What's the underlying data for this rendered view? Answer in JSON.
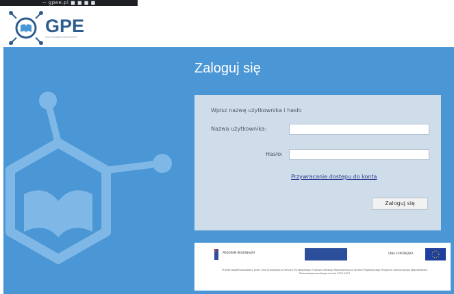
{
  "statusbar": {
    "text": "-- gpee.pl ■ ■ ■ ■"
  },
  "logo": {
    "name": "GPE",
    "tagline": "grupa projektów edukacyjnych"
  },
  "login": {
    "title": "Zaloguj się",
    "prompt": "Wpisz nazwę użytkownika i hasło",
    "username_label": "Nazwa użytkownika:",
    "username_value": "",
    "password_label": "Hasło:",
    "password_value": "",
    "recover_link": "Przywracanie dostępu do konta",
    "submit_label": "Zaloguj się"
  },
  "footer": {
    "logo1_label": "PROGRAM REGIONALNY",
    "logo3_label": "UNIA EUROPEJSKA",
    "text": "Projekt współfinansowany przez Unię Europejską w ramach Europejskiego Funduszu Rozwoju Regionalnego w ramach Regionalnego Programu Operacyjnego Województwa Zachodniopomorskiego na lata 2007-2013"
  },
  "colors": {
    "panel": "#4b97d6",
    "box": "#cfdcea",
    "logo_blue": "#2d5d8e"
  }
}
